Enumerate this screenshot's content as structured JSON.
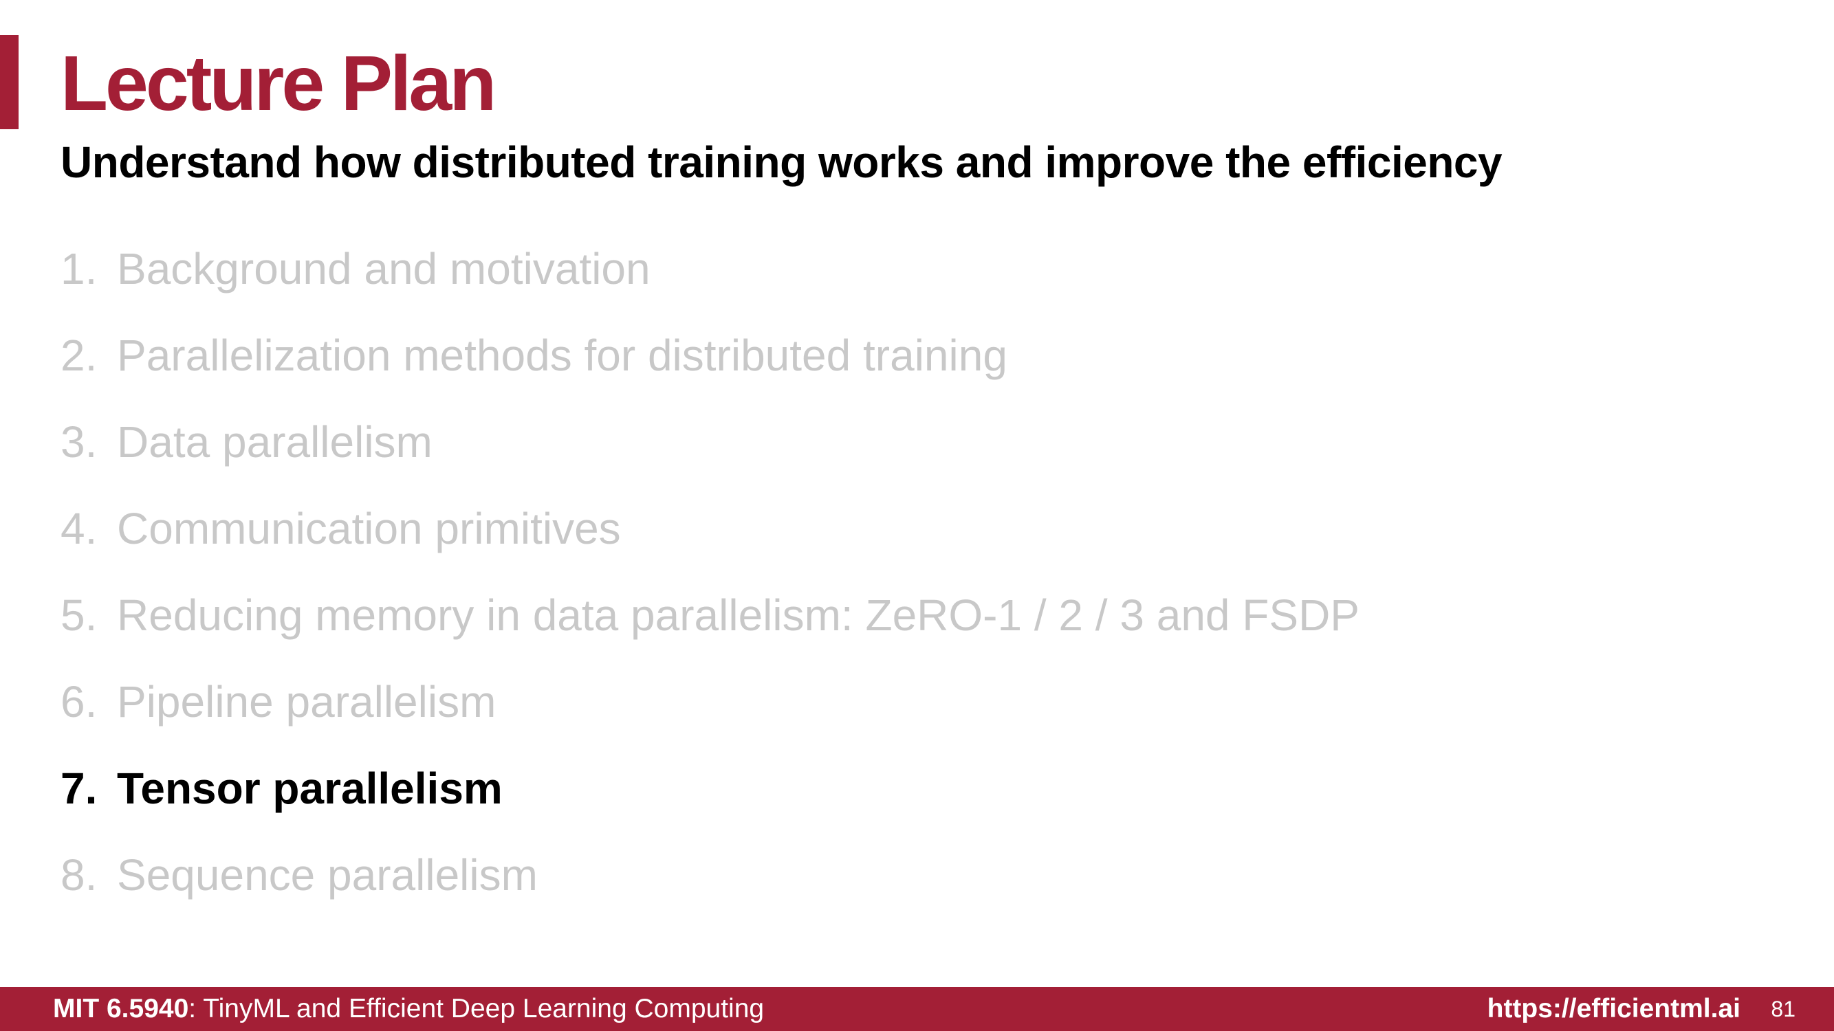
{
  "slide": {
    "title": "Lecture Plan",
    "subtitle": "Understand how distributed training works and improve the efficiency",
    "items": [
      {
        "number": "1.",
        "text": "Background and motivation",
        "active": false
      },
      {
        "number": "2.",
        "text": "Parallelization methods for distributed training",
        "active": false
      },
      {
        "number": "3.",
        "text": "Data parallelism",
        "active": false
      },
      {
        "number": "4.",
        "text": "Communication primitives",
        "active": false
      },
      {
        "number": "5.",
        "text": "Reducing memory in data parallelism: ZeRO-1 / 2 / 3 and FSDP",
        "active": false
      },
      {
        "number": "6.",
        "text": "Pipeline parallelism",
        "active": false
      },
      {
        "number": "7.",
        "text": "Tensor parallelism",
        "active": true
      },
      {
        "number": "8.",
        "text": "Sequence parallelism",
        "active": false
      }
    ]
  },
  "footer": {
    "course_code": "MIT 6.5940",
    "course_name": ": TinyML and Efficient Deep Learning Computing",
    "url": "https://efficientml.ai",
    "page_number": "81"
  },
  "colors": {
    "accent": "#a31f36",
    "inactive_text": "#c8c8c8",
    "active_text": "#000000"
  }
}
